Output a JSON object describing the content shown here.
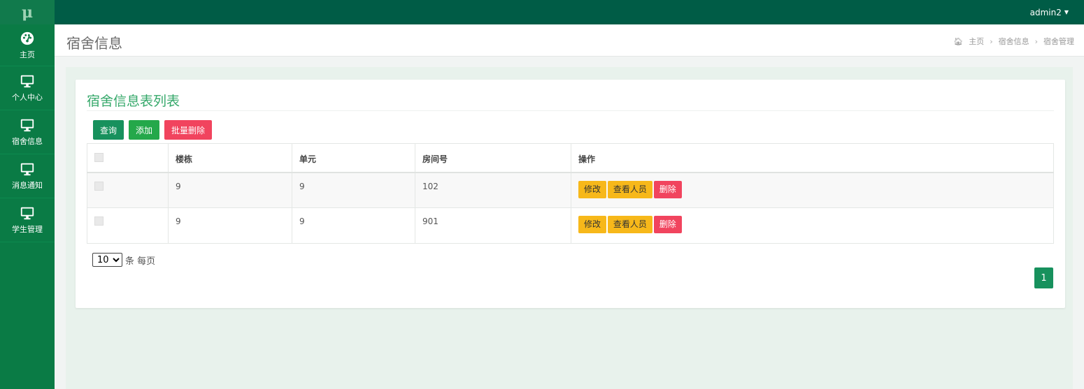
{
  "app": {
    "logo": "μ",
    "user": "admin2"
  },
  "sidebar": {
    "items": [
      {
        "label": "主页",
        "icon": "dashboard-icon"
      },
      {
        "label": "个人中心",
        "icon": "monitor-icon"
      },
      {
        "label": "宿舍信息",
        "icon": "monitor-icon"
      },
      {
        "label": "消息通知",
        "icon": "monitor-icon"
      },
      {
        "label": "学生管理",
        "icon": "monitor-icon"
      }
    ]
  },
  "header": {
    "title": "宿舍信息",
    "breadcrumb": [
      "主页",
      "宿舍信息",
      "宿舍管理"
    ]
  },
  "card": {
    "title": "宿舍信息表列表",
    "buttons": {
      "query": "查询",
      "add": "添加",
      "batch_delete": "批量删除"
    },
    "table": {
      "columns": [
        "楼栋",
        "单元",
        "房间号",
        "操作"
      ],
      "rows": [
        {
          "building": "9",
          "unit": "9",
          "room": "102"
        },
        {
          "building": "9",
          "unit": "9",
          "room": "901"
        }
      ],
      "actions": {
        "edit": "修改",
        "view": "查看人员",
        "delete": "删除"
      }
    },
    "pager": {
      "page_size": "10",
      "per_page_label": "条 每页",
      "current_page": "1"
    }
  },
  "colors": {
    "topbar": "#005c46",
    "sidebar": "#0a7b45",
    "accent": "#17915d",
    "danger": "#f1445e",
    "warning": "#f7b81a",
    "title_green": "#35a86a"
  }
}
